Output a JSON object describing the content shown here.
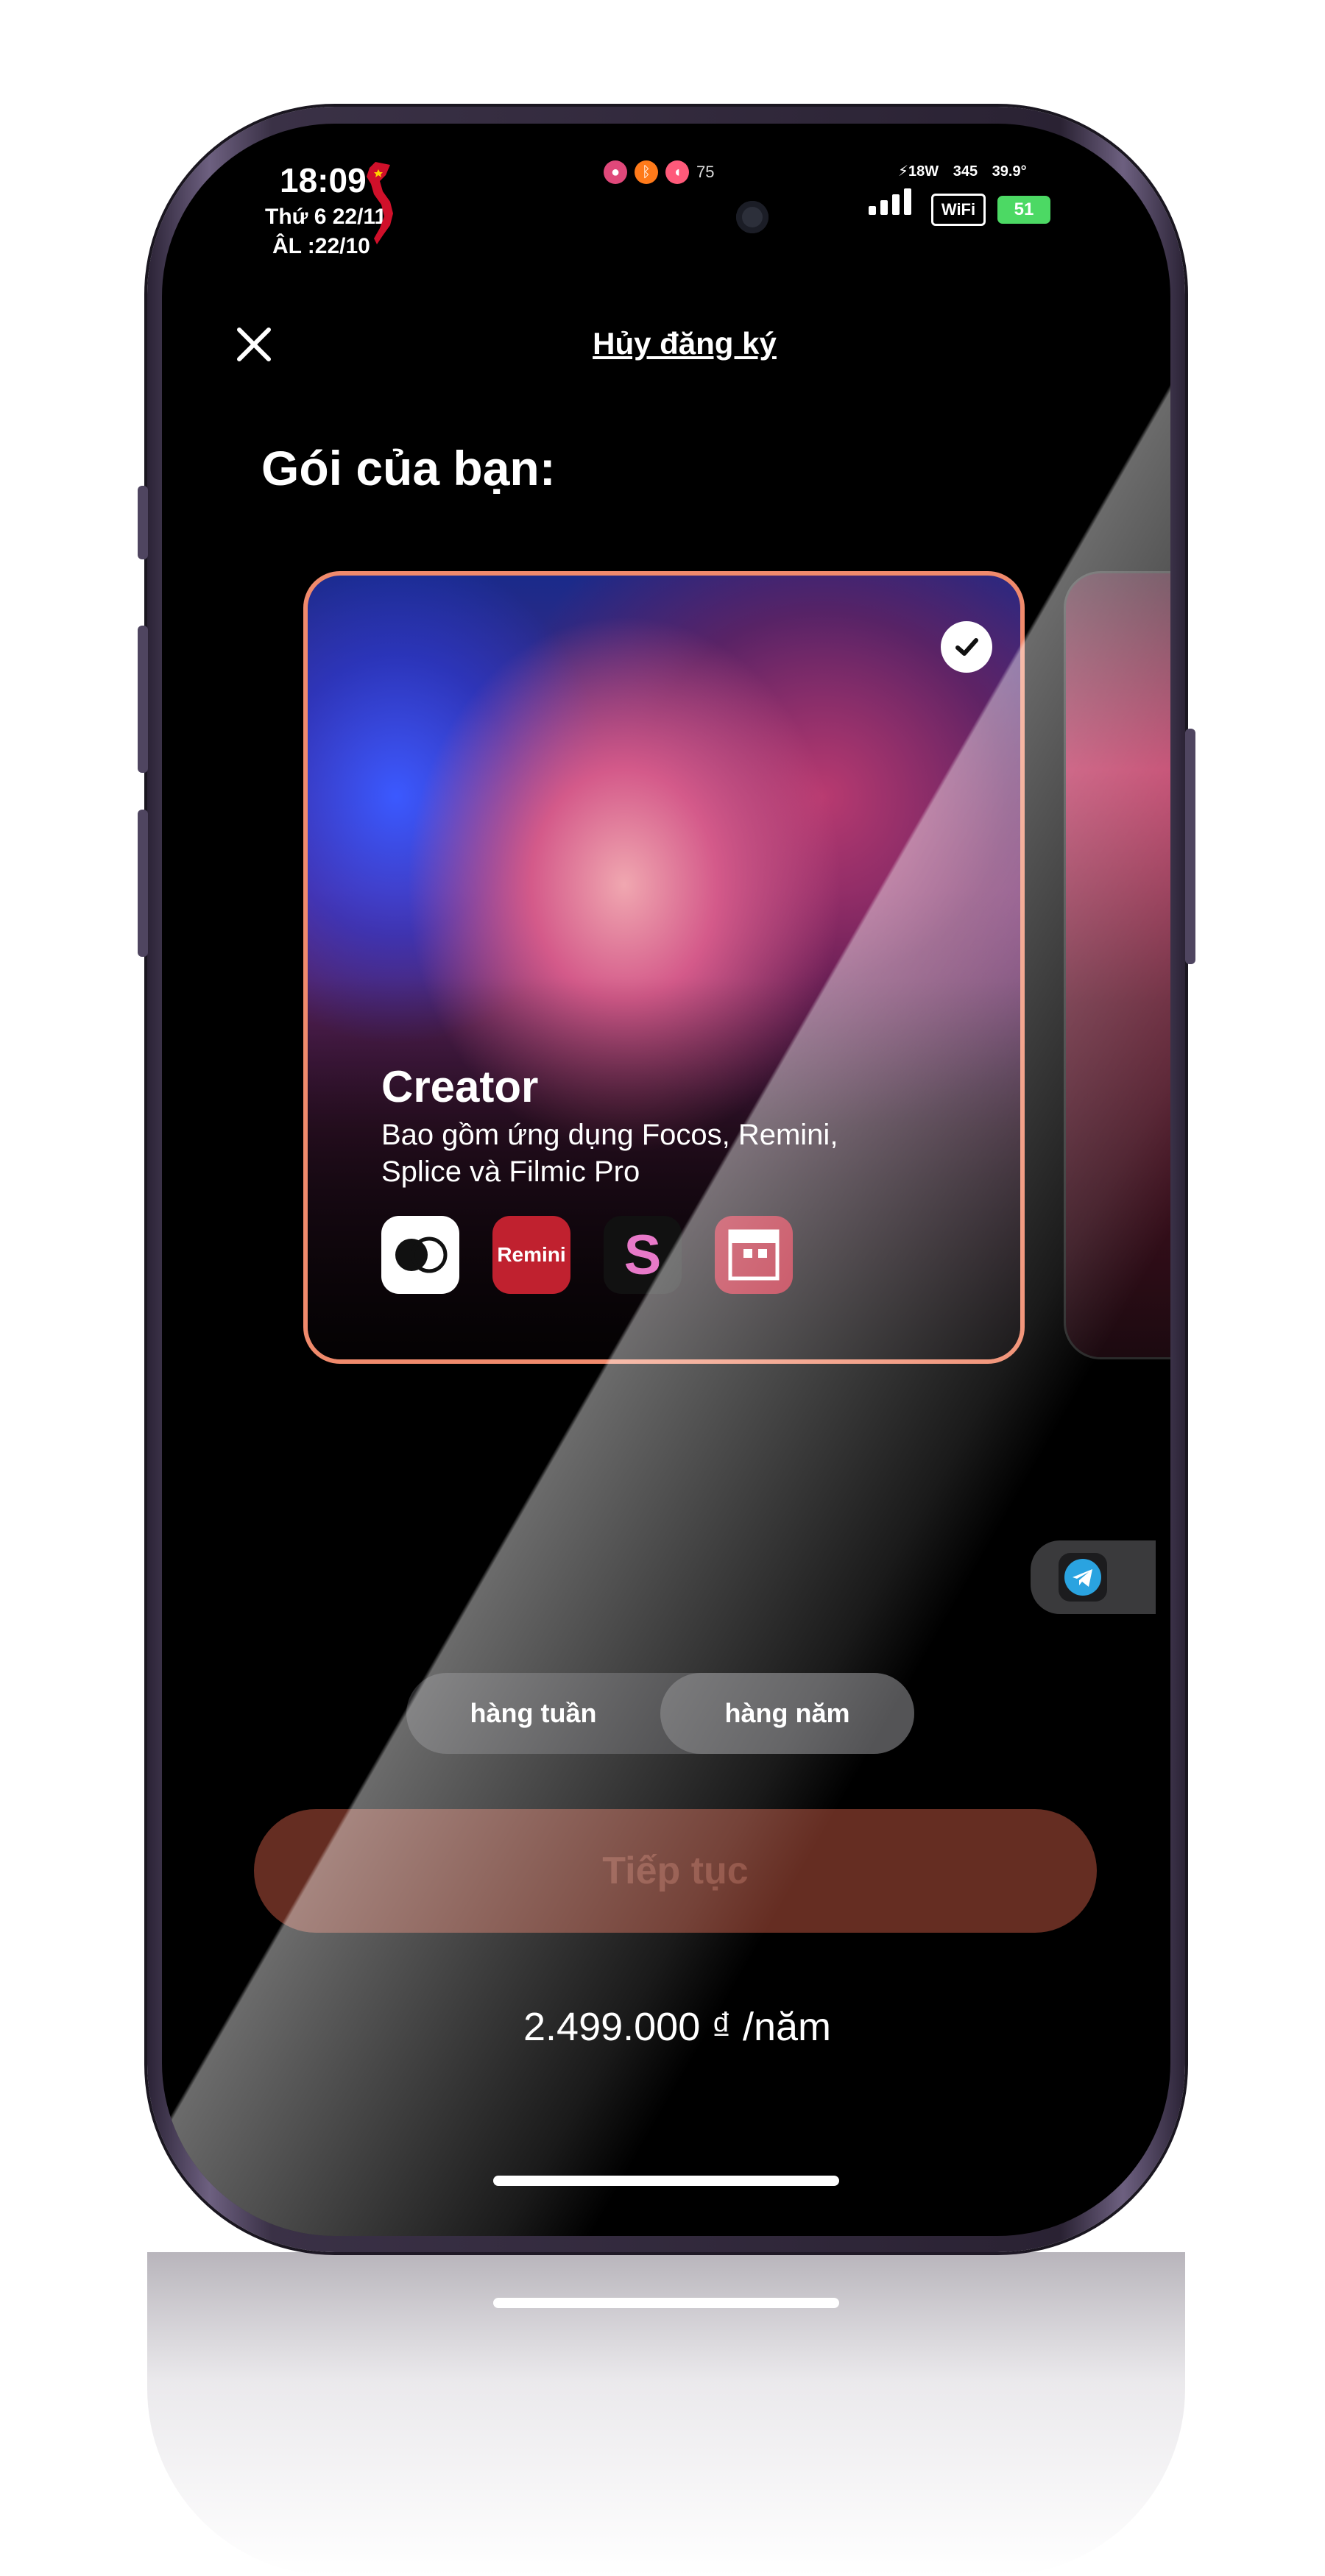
{
  "status_bar": {
    "time": "18:09",
    "date": "Thứ 6 22/11",
    "lunar": "ÂL :22/10",
    "indicator_count": "75",
    "power": "⚡18W",
    "data_rate": "345",
    "temperature": "39.9°",
    "wifi_label": "WiFi",
    "battery": "51"
  },
  "header": {
    "close_icon": "close-icon",
    "cancel_subscription": "Hủy đăng ký"
  },
  "section_title": "Gói của bạn:",
  "plan_card": {
    "title": "Creator",
    "description": "Bao gồm ứng dụng Focos, Remini, Splice và Filmic Pro",
    "selected": true,
    "border_color": "#f08a6c",
    "apps": [
      {
        "name": "focos-app-icon"
      },
      {
        "name": "remini-app-icon",
        "label": "Remini"
      },
      {
        "name": "splice-app-icon",
        "label": "S"
      },
      {
        "name": "filmic-pro-app-icon"
      }
    ]
  },
  "billing_toggle": {
    "options": [
      "hàng tuần",
      "hàng năm"
    ],
    "selected": "hàng năm"
  },
  "continue_button": {
    "label": "Tiếp tục",
    "color": "#652d22"
  },
  "price": "2.499.000 ₫ /năm",
  "telegram_icon": "telegram-icon"
}
